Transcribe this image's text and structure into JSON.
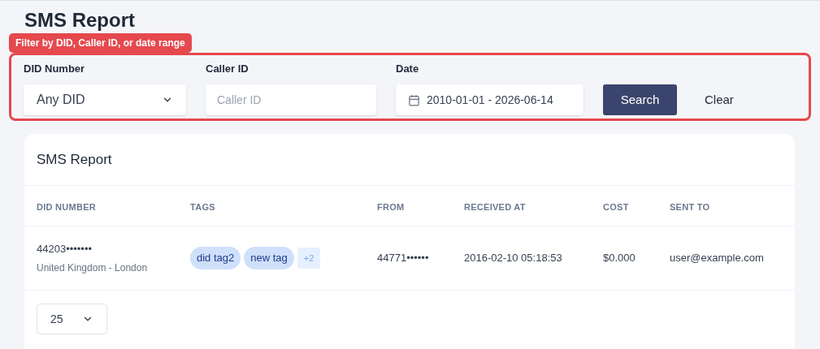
{
  "page_title": "SMS Report",
  "annotation": "Filter by DID, Caller ID, or date range",
  "filters": {
    "did": {
      "label": "DID Number",
      "value": "Any DID"
    },
    "caller": {
      "label": "Caller ID",
      "placeholder": "Caller ID"
    },
    "date": {
      "label": "Date",
      "value": "2010-01-01 - 2026-06-14"
    },
    "search_button": "Search",
    "clear_button": "Clear"
  },
  "card": {
    "title": "SMS Report",
    "table": {
      "columns": [
        "DID NUMBER",
        "TAGS",
        "FROM",
        "RECEIVED AT",
        "COST",
        "SENT TO"
      ],
      "rows": [
        {
          "did": "44203•••••••",
          "location": "United Kingdom - London",
          "tags": [
            "did tag2",
            "new tag"
          ],
          "more_tags": "+2",
          "from": "44771••••••",
          "received_at": "2016-02-10 05:18:53",
          "cost": "$0.000",
          "sent_to": "user@example.com"
        }
      ]
    },
    "per_page": "25"
  }
}
